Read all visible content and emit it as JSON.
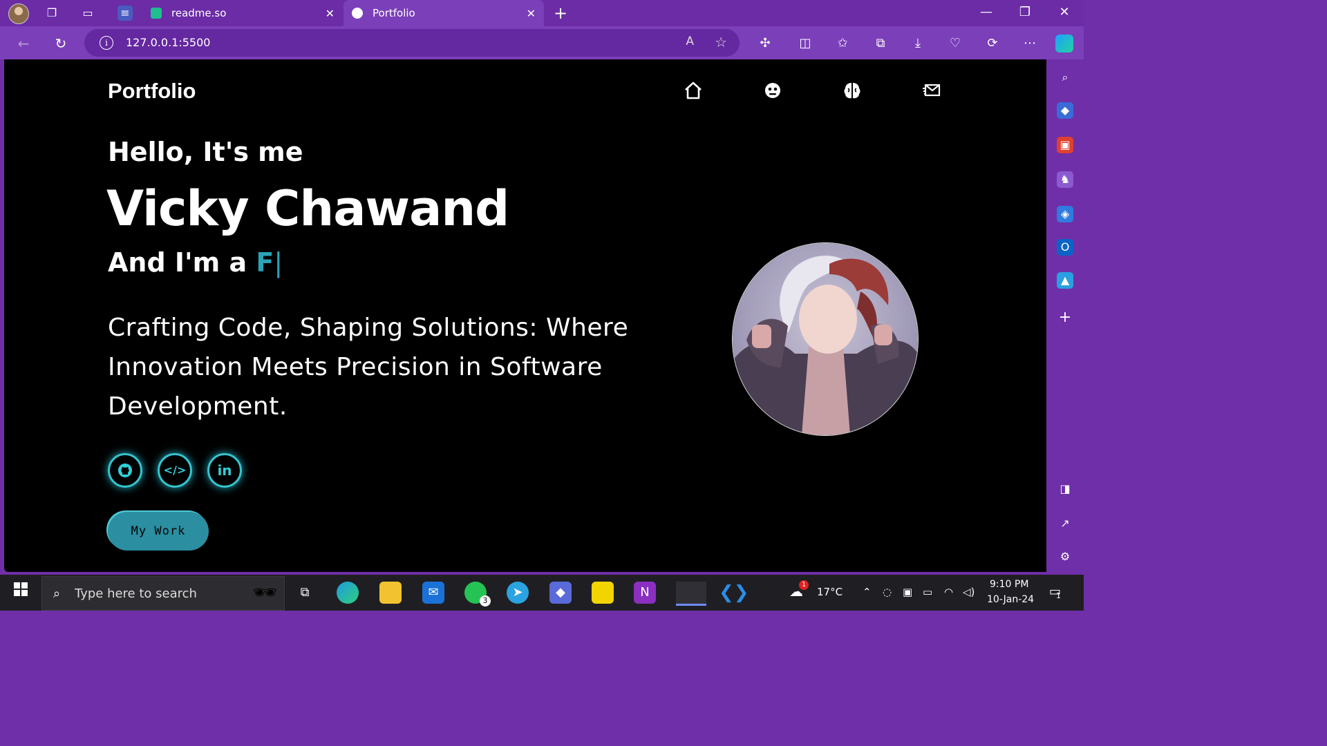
{
  "browser": {
    "tabs": [
      {
        "label": "readme.so",
        "active": false
      },
      {
        "label": "Portfolio",
        "active": true
      }
    ],
    "url": "127.0.0.1:5500",
    "new_tab_symbol": "+"
  },
  "page": {
    "logo": "Portfolio",
    "nav_icons": [
      "home-icon",
      "about-icon",
      "skills-icon",
      "contact-icon"
    ],
    "greeting": "Hello, It's me",
    "name": "Vicky Chawand",
    "role_prefix": "And I'm a ",
    "role_typed": "F",
    "role_cursor": "|",
    "tagline": "Crafting Code, Shaping Solutions: Where Innovation Meets Precision in Software Development.",
    "social": [
      {
        "icon": "github-icon",
        "glyph": "◎"
      },
      {
        "icon": "code-icon",
        "glyph": "</>"
      },
      {
        "icon": "linkedin-icon",
        "glyph": "in"
      }
    ],
    "cta_label": "My Work",
    "colors": {
      "accent": "#2aa3b7",
      "button": "#2b8ea1",
      "background": "#000000"
    }
  },
  "taskbar": {
    "search_placeholder": "Type here to search",
    "whatsapp_badge": "3",
    "weather_temp": "17°C",
    "weather_badge": "1",
    "time": "9:10 PM",
    "date": "10-Jan-24",
    "notification_count": "1"
  }
}
